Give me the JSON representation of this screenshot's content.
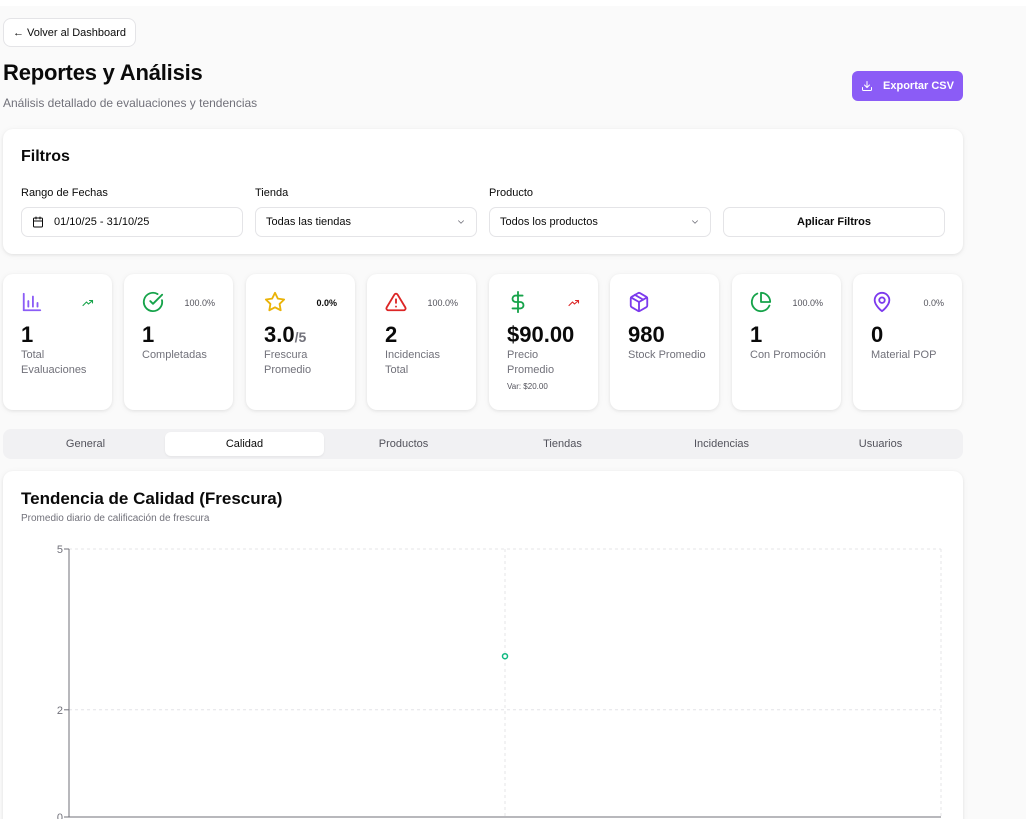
{
  "header": {
    "back_label": "← Volver al Dashboard",
    "title": "Reportes y Análisis",
    "subtitle": "Análisis detallado de evaluaciones y tendencias",
    "export_label": "Exportar CSV"
  },
  "filters": {
    "title": "Filtros",
    "date_label": "Rango de Fechas",
    "date_value": "01/10/25 - 31/10/25",
    "store_label": "Tienda",
    "store_value": "Todas las tiendas",
    "product_label": "Producto",
    "product_value": "Todos los productos",
    "apply_label": "Aplicar Filtros"
  },
  "kpis": [
    {
      "icon": "bar-chart-icon",
      "value": "1",
      "label": "Total Evaluaciones",
      "badge": "",
      "trend": "up",
      "color": "#8b5cf6"
    },
    {
      "icon": "check-circle-icon",
      "value": "1",
      "label": "Completadas",
      "badge": "100.0%",
      "color": "#16a34a"
    },
    {
      "icon": "star-icon",
      "value": "3.0",
      "suffix": "/5",
      "label": "Frescura Promedio",
      "badge": "0.0%",
      "color": "#eab308"
    },
    {
      "icon": "alert-triangle-icon",
      "value": "2",
      "label": "Incidencias Total",
      "badge": "100.0%",
      "color": "#dc2626"
    },
    {
      "icon": "dollar-icon",
      "value": "$90.00",
      "label": "Precio Promedio",
      "sub": "Var: $20.00",
      "trend": "up",
      "color": "#16a34a"
    },
    {
      "icon": "box-icon",
      "value": "980",
      "label": "Stock Promedio",
      "badge": "",
      "color": "#7c3aed"
    },
    {
      "icon": "pie-chart-icon",
      "value": "1",
      "label": "Con Promoción",
      "badge": "100.0%",
      "color": "#16a34a"
    },
    {
      "icon": "map-pin-icon",
      "value": "0",
      "label": "Material POP",
      "badge": "0.0%",
      "color": "#7c3aed"
    }
  ],
  "tabs": [
    "General",
    "Calidad",
    "Productos",
    "Tiendas",
    "Incidencias",
    "Usuarios"
  ],
  "active_tab": "Calidad",
  "chart": {
    "title": "Tendencia de Calidad (Frescura)",
    "subtitle": "Promedio diario de calificación de frescura"
  },
  "chart_data": {
    "type": "line",
    "title": "Tendencia de Calidad (Frescura)",
    "subtitle": "Promedio diario de calificación de frescura",
    "yticks": [
      "5",
      "2",
      "0"
    ],
    "ylim": [
      0,
      5
    ],
    "grid": true,
    "series": [
      {
        "values": [
          3.0
        ],
        "color": "#10b981"
      }
    ]
  }
}
